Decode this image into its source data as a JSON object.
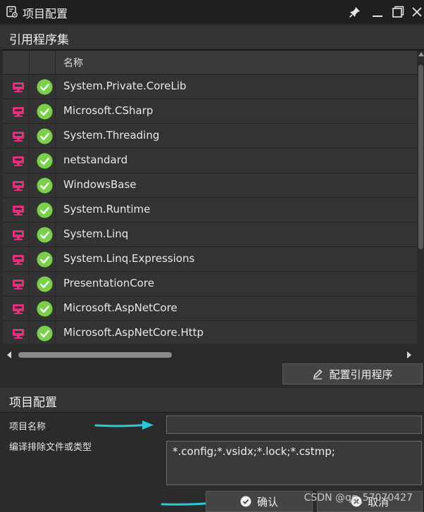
{
  "window": {
    "title": "项目配置",
    "controls": [
      "pin-icon",
      "minimize-icon",
      "maximize-icon",
      "close-icon"
    ]
  },
  "assemblies_section": {
    "title": "引用程序集",
    "columns": [
      "",
      "",
      "名称"
    ],
    "rows": [
      {
        "name": "System.Private.CoreLib"
      },
      {
        "name": "Microsoft.CSharp"
      },
      {
        "name": "System.Threading"
      },
      {
        "name": "netstandard"
      },
      {
        "name": "WindowsBase"
      },
      {
        "name": "System.Runtime"
      },
      {
        "name": "System.Linq"
      },
      {
        "name": "System.Linq.Expressions"
      },
      {
        "name": "PresentationCore"
      },
      {
        "name": "Microsoft.AspNetCore"
      },
      {
        "name": "Microsoft.AspNetCore.Http"
      }
    ],
    "configure_button": "配置引用程序"
  },
  "project_section": {
    "title": "项目配置",
    "name_label": "项目名称",
    "name_value": "",
    "exclude_label": "编译排除文件或类型",
    "exclude_value": "*.config;*.vsidx;*.lock;*.cstmp;"
  },
  "footer": {
    "confirm_button": "确认",
    "cancel_button": "取消"
  },
  "watermark": "CSDN @qq_57070427",
  "colors": {
    "accent_arrow": "#28c8d8",
    "check_green": "#7ad04a",
    "type_icon_pink": "#e0307f"
  }
}
